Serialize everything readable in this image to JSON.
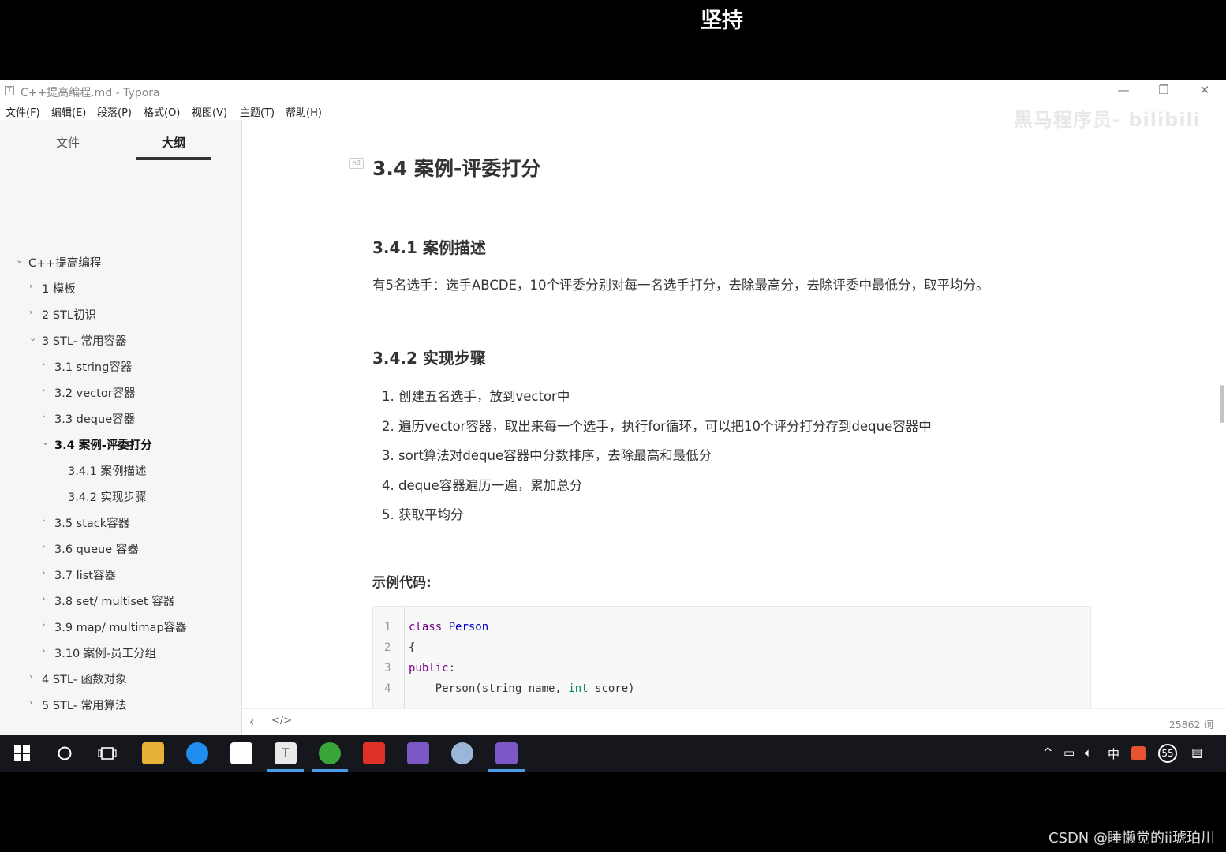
{
  "caption": "坚持",
  "window": {
    "title": "C++提高编程.md - Typora",
    "app_icon": "T",
    "controls": {
      "minimize": "—",
      "restore": "❐",
      "close": "✕"
    }
  },
  "menu": [
    "文件(F)",
    "编辑(E)",
    "段落(P)",
    "格式(O)",
    "视图(V)",
    "主题(T)",
    "帮助(H)"
  ],
  "sidebar": {
    "tabs": [
      "文件",
      "大纲"
    ],
    "active_tab": "大纲",
    "outline": [
      {
        "label": "C++提高编程",
        "expanded": true,
        "level": 0
      },
      {
        "label": "1 模板",
        "expanded": false,
        "level": 1
      },
      {
        "label": "2 STL初识",
        "expanded": false,
        "level": 1
      },
      {
        "label": "3 STL- 常用容器",
        "expanded": true,
        "level": 1
      },
      {
        "label": "3.1 string容器",
        "expanded": false,
        "level": 2
      },
      {
        "label": "3.2 vector容器",
        "expanded": false,
        "level": 2
      },
      {
        "label": "3.3 deque容器",
        "expanded": false,
        "level": 2
      },
      {
        "label": "3.4 案例-评委打分",
        "expanded": true,
        "level": 2,
        "active": true
      },
      {
        "label": "3.4.1 案例描述",
        "level": 3
      },
      {
        "label": "3.4.2 实现步骤",
        "level": 3
      },
      {
        "label": "3.5 stack容器",
        "expanded": false,
        "level": 2
      },
      {
        "label": "3.6 queue 容器",
        "expanded": false,
        "level": 2
      },
      {
        "label": "3.7 list容器",
        "expanded": false,
        "level": 2
      },
      {
        "label": "3.8 set/ multiset 容器",
        "expanded": false,
        "level": 2
      },
      {
        "label": "3.9 map/ multimap容器",
        "expanded": false,
        "level": 2
      },
      {
        "label": "3.10 案例-员工分组",
        "expanded": false,
        "level": 2
      },
      {
        "label": "4 STL- 函数对象",
        "expanded": false,
        "level": 1
      },
      {
        "label": "5 STL- 常用算法",
        "expanded": false,
        "level": 1
      }
    ]
  },
  "doc": {
    "heading_badge": "h3",
    "h2": "3.4 案例-评委打分",
    "h3_desc": "3.4.1 案例描述",
    "desc": "有5名选手：选手ABCDE，10个评委分别对每一名选手打分，去除最高分，去除评委中最低分，取平均分。",
    "h3_steps": "3.4.2 实现步骤",
    "steps": [
      "1. 创建五名选手，放到vector中",
      "2. 遍历vector容器，取出来每一个选手，执行for循环，可以把10个评分打分存到deque容器中",
      "3. sort算法对deque容器中分数排序，去除最高和最低分",
      "4. deque容器遍历一遍，累加总分",
      "5. 获取平均分"
    ],
    "code_label": "示例代码:",
    "code_lines": [
      "1",
      "2",
      "3",
      "4"
    ]
  },
  "watermark": "黑马程序员- bilibili",
  "footer": {
    "back": "‹",
    "source_toggle": "</>",
    "word_count": "25862 词"
  },
  "taskbar": {
    "tray_up": "^",
    "ime": "中",
    "badge": "55"
  },
  "csdn": "CSDN @睡懒觉的ii琥珀川"
}
